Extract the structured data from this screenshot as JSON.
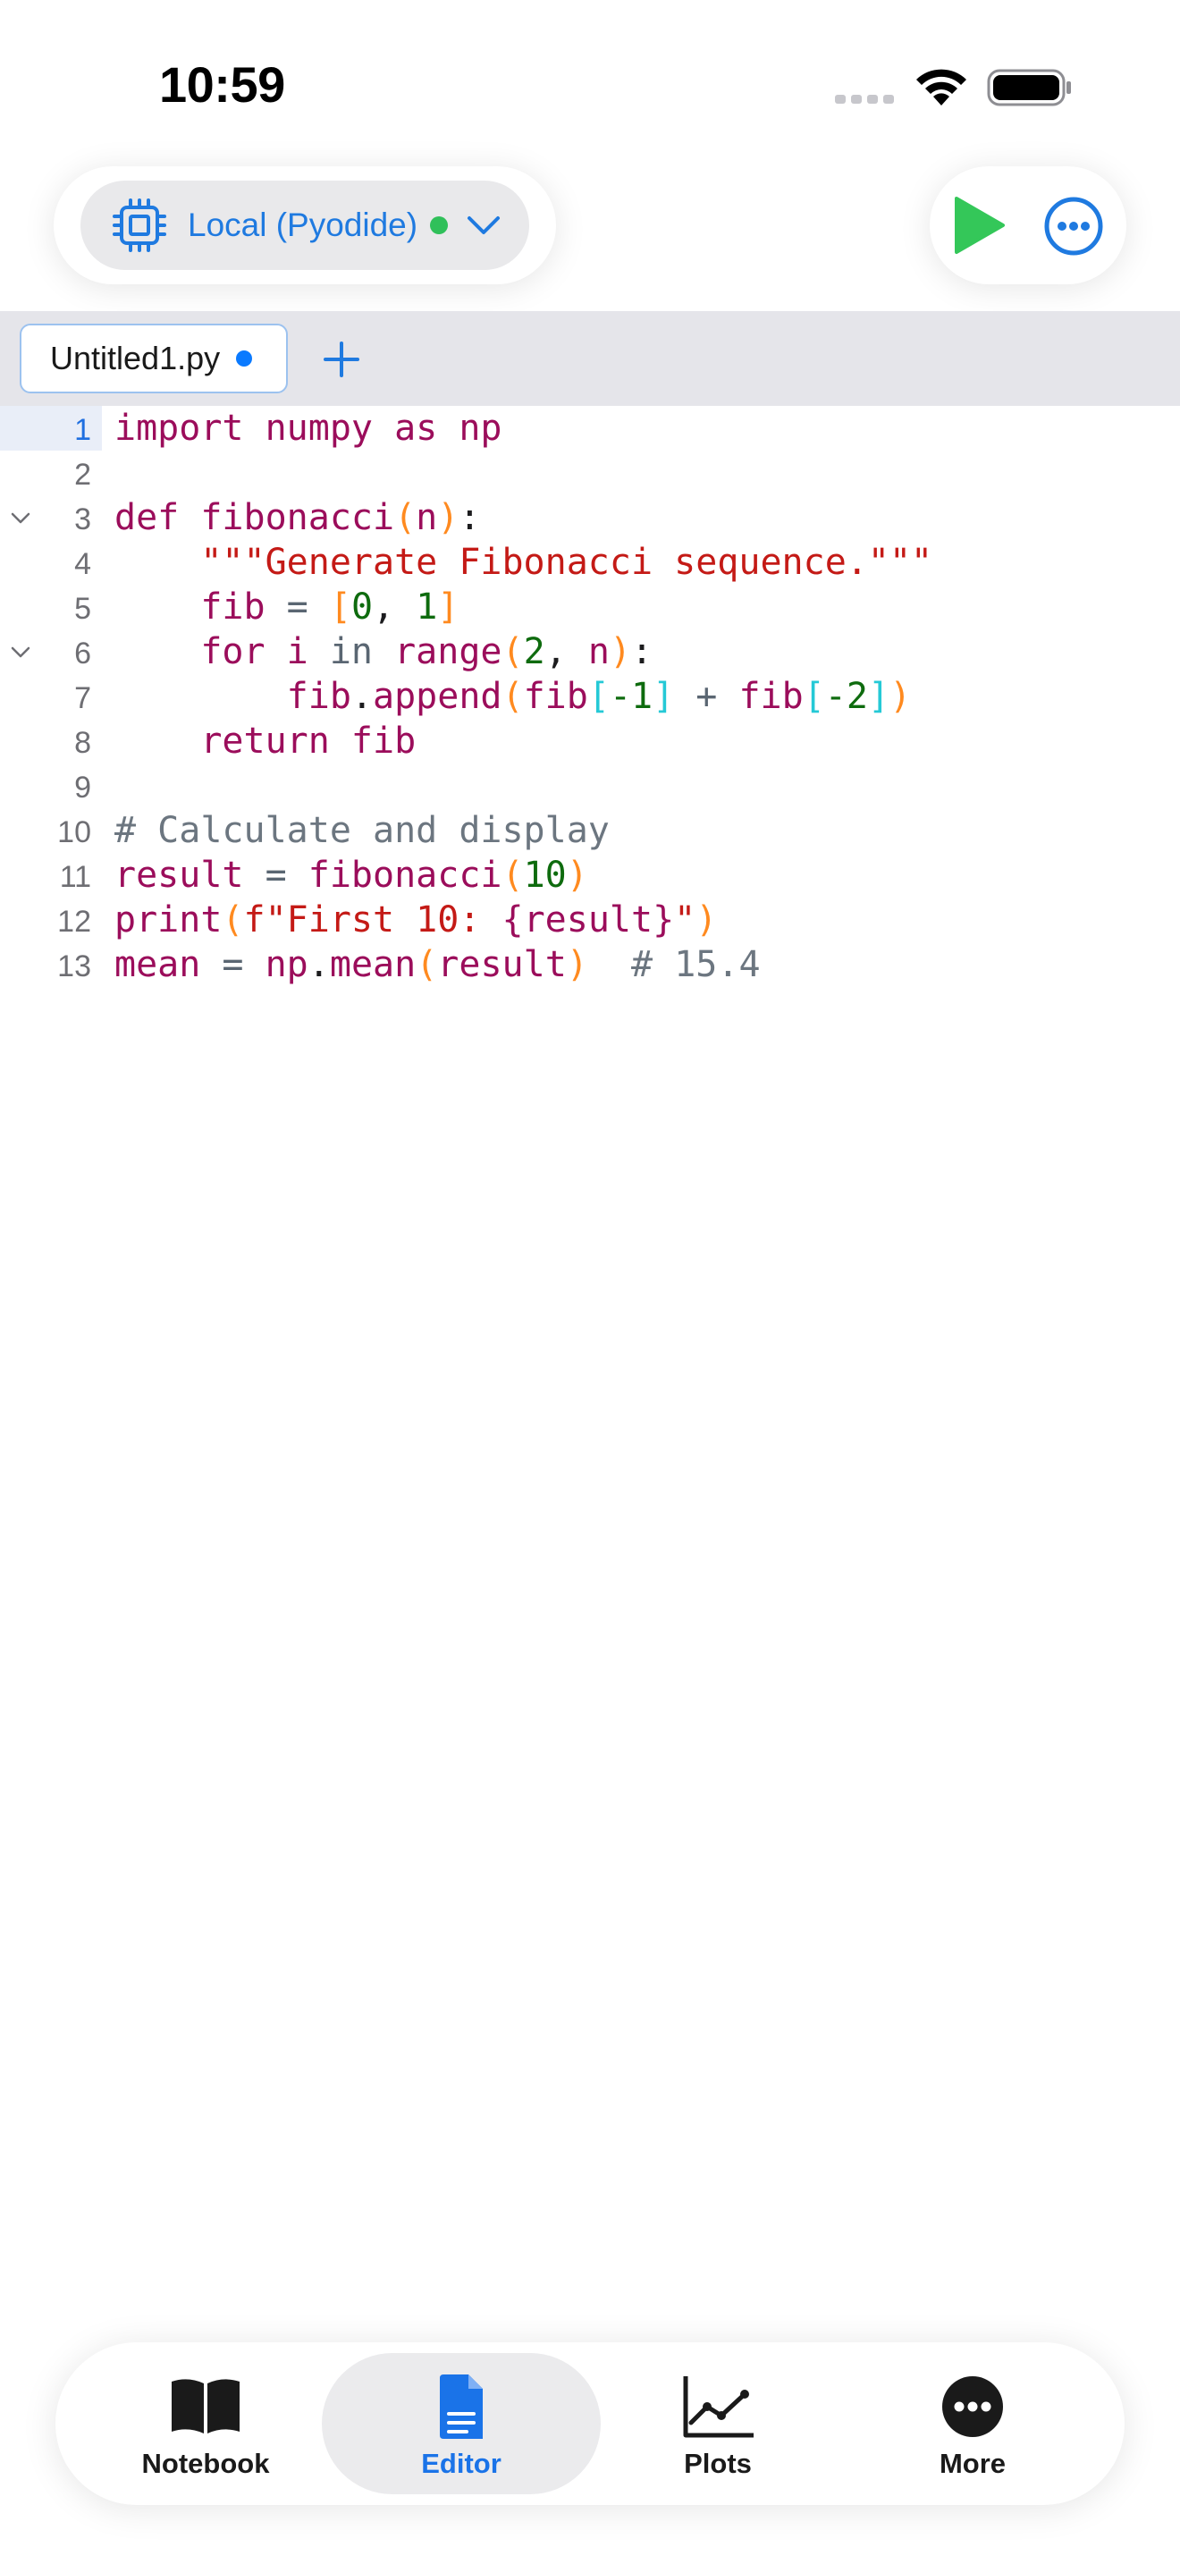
{
  "status_bar": {
    "time": "10:59"
  },
  "toolbar": {
    "kernel_label": "Local (Pyodide)",
    "kernel_status": "connected",
    "run_icon": "play-icon",
    "more_icon": "ellipsis-circle-icon"
  },
  "tabs": {
    "active_file": "Untitled1.py",
    "unsaved": true,
    "add_icon": "plus-icon"
  },
  "editor": {
    "active_line": 1,
    "lines": [
      {
        "n": "1",
        "tokens": [
          {
            "t": "import numpy as np",
            "c": "kw"
          }
        ]
      },
      {
        "n": "2",
        "tokens": []
      },
      {
        "n": "3",
        "fold": true,
        "tokens": [
          {
            "t": "def fibonacci",
            "c": "kw"
          },
          {
            "t": "(",
            "c": "br1"
          },
          {
            "t": "n",
            "c": "id"
          },
          {
            "t": ")",
            "c": "br1"
          },
          {
            "t": ":",
            "c": "pl"
          }
        ]
      },
      {
        "n": "4",
        "tokens": [
          {
            "t": "    ",
            "c": "pl"
          },
          {
            "t": "\"\"\"Generate Fibonacci sequence.\"\"\"",
            "c": "str"
          }
        ]
      },
      {
        "n": "5",
        "tokens": [
          {
            "t": "    fib ",
            "c": "id"
          },
          {
            "t": "=",
            "c": "bw"
          },
          {
            "t": " ",
            "c": "pl"
          },
          {
            "t": "[",
            "c": "br1"
          },
          {
            "t": "0",
            "c": "num"
          },
          {
            "t": ", ",
            "c": "pl"
          },
          {
            "t": "1",
            "c": "num"
          },
          {
            "t": "]",
            "c": "br1"
          }
        ]
      },
      {
        "n": "6",
        "fold": true,
        "tokens": [
          {
            "t": "    for i ",
            "c": "kw"
          },
          {
            "t": "in",
            "c": "bw"
          },
          {
            "t": " range",
            "c": "id"
          },
          {
            "t": "(",
            "c": "br1"
          },
          {
            "t": "2",
            "c": "num"
          },
          {
            "t": ", ",
            "c": "pl"
          },
          {
            "t": "n",
            "c": "id"
          },
          {
            "t": ")",
            "c": "br1"
          },
          {
            "t": ":",
            "c": "pl"
          }
        ]
      },
      {
        "n": "7",
        "tokens": [
          {
            "t": "        fib",
            "c": "id"
          },
          {
            "t": ".",
            "c": "pl"
          },
          {
            "t": "append",
            "c": "id"
          },
          {
            "t": "(",
            "c": "br1"
          },
          {
            "t": "fib",
            "c": "id"
          },
          {
            "t": "[",
            "c": "br2"
          },
          {
            "t": "-1",
            "c": "num"
          },
          {
            "t": "]",
            "c": "br2"
          },
          {
            "t": " + ",
            "c": "bw"
          },
          {
            "t": "fib",
            "c": "id"
          },
          {
            "t": "[",
            "c": "br2"
          },
          {
            "t": "-2",
            "c": "num"
          },
          {
            "t": "]",
            "c": "br2"
          },
          {
            "t": ")",
            "c": "br1"
          }
        ]
      },
      {
        "n": "8",
        "tokens": [
          {
            "t": "    return fib",
            "c": "kw"
          }
        ]
      },
      {
        "n": "9",
        "tokens": []
      },
      {
        "n": "10",
        "tokens": [
          {
            "t": "# Calculate and display",
            "c": "cm"
          }
        ]
      },
      {
        "n": "11",
        "tokens": [
          {
            "t": "result ",
            "c": "id"
          },
          {
            "t": "=",
            "c": "bw"
          },
          {
            "t": " fibonacci",
            "c": "id"
          },
          {
            "t": "(",
            "c": "br1"
          },
          {
            "t": "10",
            "c": "num"
          },
          {
            "t": ")",
            "c": "br1"
          }
        ]
      },
      {
        "n": "12",
        "tokens": [
          {
            "t": "print",
            "c": "id"
          },
          {
            "t": "(",
            "c": "br1"
          },
          {
            "t": "f\"First 10: ",
            "c": "str"
          },
          {
            "t": "{result}",
            "c": "id"
          },
          {
            "t": "\"",
            "c": "str"
          },
          {
            "t": ")",
            "c": "br1"
          }
        ]
      },
      {
        "n": "13",
        "tokens": [
          {
            "t": "mean ",
            "c": "id"
          },
          {
            "t": "=",
            "c": "bw"
          },
          {
            "t": " np",
            "c": "id"
          },
          {
            "t": ".",
            "c": "pl"
          },
          {
            "t": "mean",
            "c": "id"
          },
          {
            "t": "(",
            "c": "br1"
          },
          {
            "t": "result",
            "c": "id"
          },
          {
            "t": ")",
            "c": "br1"
          },
          {
            "t": "  # 15.4",
            "c": "cm"
          }
        ]
      }
    ]
  },
  "bottom_nav": {
    "selected": "editor",
    "items": [
      {
        "id": "notebook",
        "label": "Notebook",
        "icon": "book-icon"
      },
      {
        "id": "editor",
        "label": "Editor",
        "icon": "document-icon"
      },
      {
        "id": "plots",
        "label": "Plots",
        "icon": "line-chart-icon"
      },
      {
        "id": "more",
        "label": "More",
        "icon": "ellipsis-circle-icon"
      }
    ]
  },
  "colors": {
    "accent": "#1a73e8",
    "run": "#34c759",
    "status_ok": "#30c05a",
    "keyword": "#9b0d5b",
    "string": "#c41a16",
    "number": "#0e6b0e",
    "bracket_outer": "#ff8a1f",
    "bracket_inner": "#25c9d6",
    "comment": "#6c7680"
  }
}
